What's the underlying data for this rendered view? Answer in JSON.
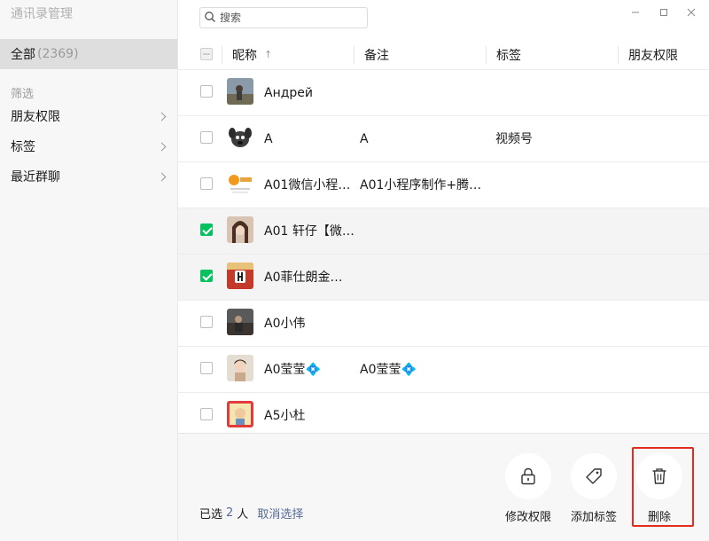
{
  "window": {
    "title": "通讯录管理"
  },
  "sidebar": {
    "all_label": "全部",
    "all_count": "(2369)",
    "filter_heading": "筛选",
    "items": [
      {
        "label": "朋友权限"
      },
      {
        "label": "标签"
      },
      {
        "label": "最近群聊"
      }
    ]
  },
  "search": {
    "placeholder": "搜索"
  },
  "table": {
    "columns": {
      "nickname": "昵称",
      "remark": "备注",
      "tag": "标签",
      "permission": "朋友权限"
    },
    "sort_arrow": "↑",
    "rows": [
      {
        "nickname": "Андрей",
        "remark": "",
        "tag": "",
        "checked": false,
        "avatar": "photo-person-outdoor"
      },
      {
        "nickname": "A",
        "remark": "A",
        "tag": "视频号",
        "checked": false,
        "avatar": "cartoon-dog"
      },
      {
        "nickname": "A01微信小程…",
        "remark": "A01小程序制作+腾…",
        "tag": "",
        "checked": false,
        "avatar": "logo-orange"
      },
      {
        "nickname": "A01 轩仔【微…",
        "remark": "",
        "tag": "",
        "checked": true,
        "avatar": "photo-woman"
      },
      {
        "nickname": "A0菲仕朗金…",
        "remark": "",
        "tag": "",
        "checked": true,
        "avatar": "logo-red"
      },
      {
        "nickname": "A0小伟",
        "remark": "",
        "tag": "",
        "checked": false,
        "avatar": "photo-dark"
      },
      {
        "nickname": "A0莹莹💠",
        "remark": "A0莹莹💠",
        "tag": "",
        "checked": false,
        "avatar": "photo-woman-2"
      },
      {
        "nickname": "A5小杜",
        "remark": "",
        "tag": "",
        "checked": false,
        "avatar": "photo-framed"
      }
    ]
  },
  "footer": {
    "selected_prefix": "已选",
    "selected_count": "2",
    "selected_unit": "人",
    "cancel_label": "取消选择",
    "actions": [
      {
        "label": "修改权限",
        "icon": "lock-icon"
      },
      {
        "label": "添加标签",
        "icon": "tag-icon"
      },
      {
        "label": "删除",
        "icon": "trash-icon",
        "highlighted": true
      }
    ]
  },
  "colors": {
    "accent_green": "#07c160",
    "link_blue": "#576b95",
    "highlight_red": "#e32b20",
    "sidebar_bg": "#f7f7f7"
  }
}
